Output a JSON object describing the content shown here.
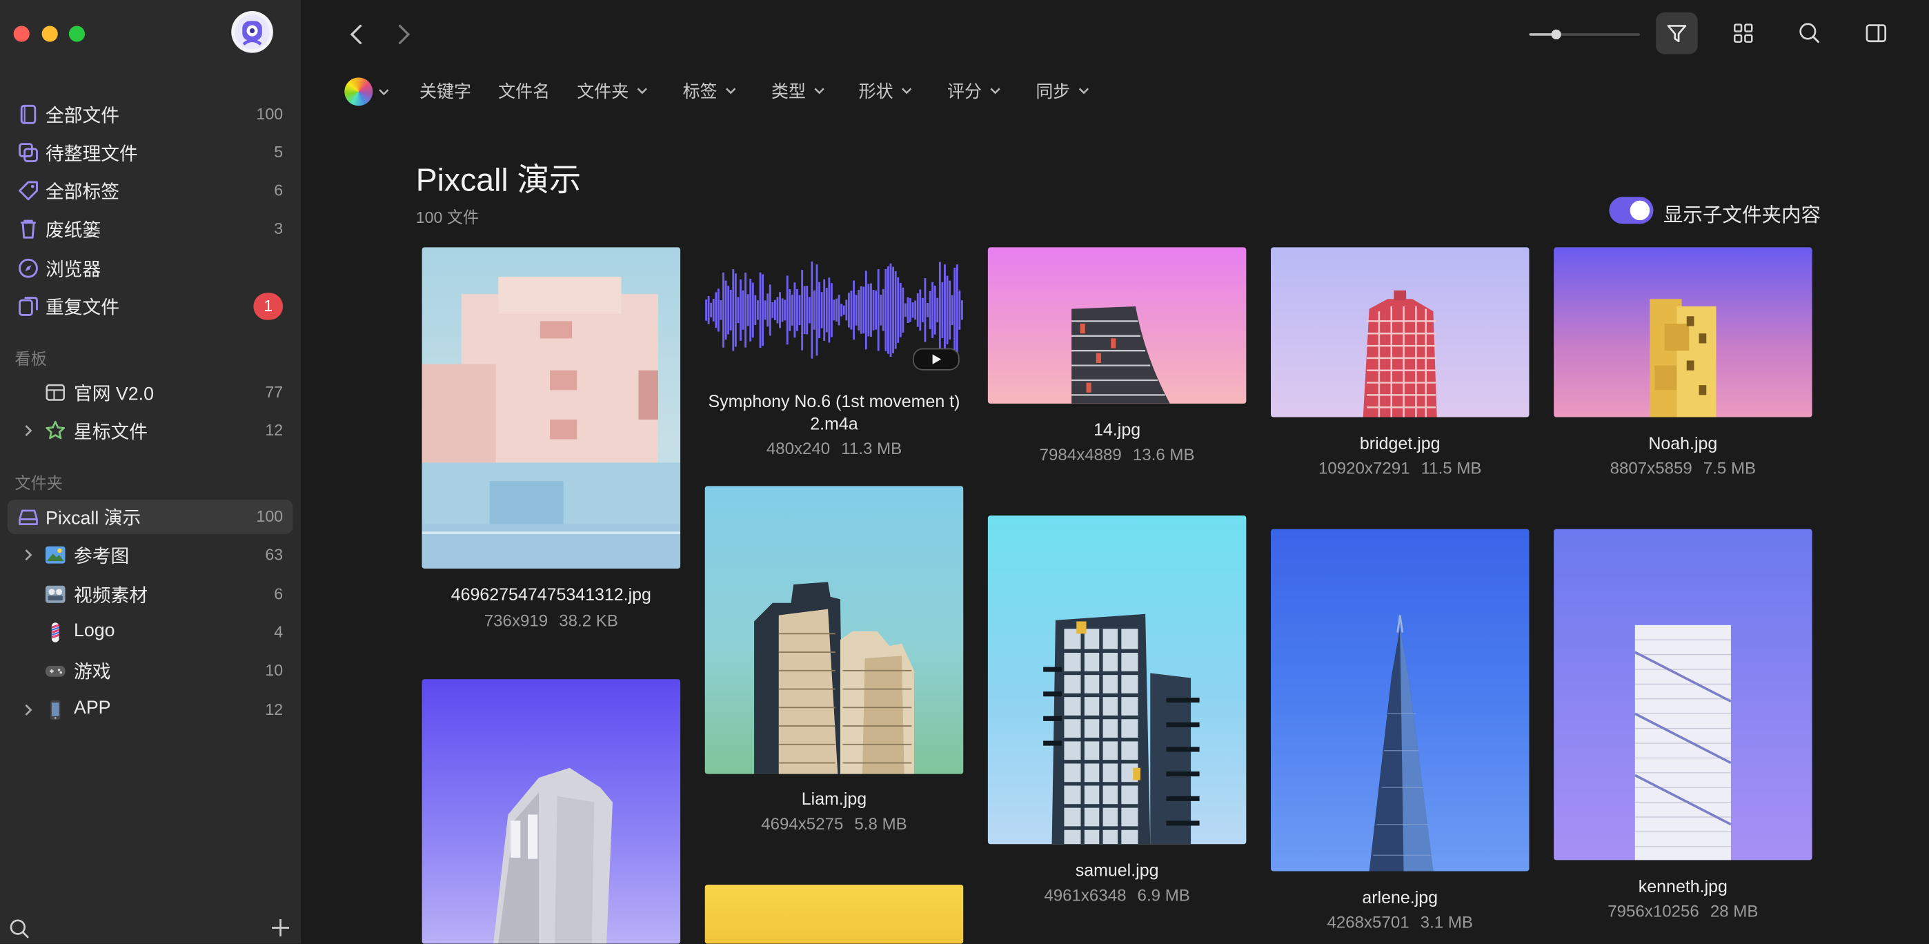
{
  "sidebar": {
    "library_items": [
      {
        "label": "全部文件",
        "count": "100",
        "icon": "all-files-icon"
      },
      {
        "label": "待整理文件",
        "count": "5",
        "icon": "unsorted-files-icon"
      },
      {
        "label": "全部标签",
        "count": "6",
        "icon": "tag-icon"
      },
      {
        "label": "废纸篓",
        "count": "3",
        "icon": "trash-icon"
      },
      {
        "label": "浏览器",
        "icon": "compass-icon"
      },
      {
        "label": "重复文件",
        "badge": "1",
        "icon": "duplicate-icon"
      }
    ],
    "boards_title": "看板",
    "boards": [
      {
        "label": "官网 V2.0",
        "count": "77",
        "icon": "board-icon"
      },
      {
        "label": "星标文件",
        "count": "12",
        "icon": "star-icon"
      }
    ],
    "folders_title": "文件夹",
    "folders": [
      {
        "label": "Pixcall 演示",
        "count": "100",
        "icon": "drive-icon"
      },
      {
        "label": "参考图",
        "count": "63",
        "icon": "picture-folder-icon"
      },
      {
        "label": "视频素材",
        "count": "6",
        "icon": "video-folder-icon"
      },
      {
        "label": "Logo",
        "count": "4",
        "icon": "logo-folder-icon"
      },
      {
        "label": "游戏",
        "count": "10",
        "icon": "game-folder-icon"
      },
      {
        "label": "APP",
        "count": "12",
        "icon": "phone-folder-icon"
      }
    ]
  },
  "filters": {
    "keyword": "关键字",
    "filename": "文件名",
    "folder": "文件夹",
    "tags": "标签",
    "type": "类型",
    "shape": "形状",
    "rating": "评分",
    "sync": "同步"
  },
  "header": {
    "title": "Pixcall 演示",
    "subtitle": "100 文件",
    "toggle_label": "显示子文件夹内容",
    "toggle_on": true
  },
  "files": [
    {
      "name": "469627547475341312.jpg",
      "dims": "736x919",
      "size": "38.2 KB"
    },
    {
      "name": "Symphony No.6 (1st movemen t) 2.m4a",
      "dims": "480x240",
      "size": "11.3 MB"
    },
    {
      "name": "14.jpg",
      "dims": "7984x4889",
      "size": "13.6 MB"
    },
    {
      "name": "bridget.jpg",
      "dims": "10920x7291",
      "size": "11.5 MB"
    },
    {
      "name": "Noah.jpg",
      "dims": "8807x5859",
      "size": "7.5 MB"
    },
    {
      "name": "Liam.jpg",
      "dims": "4694x5275",
      "size": "5.8 MB"
    },
    {
      "name": "samuel.jpg",
      "dims": "4961x6348",
      "size": "6.9 MB"
    },
    {
      "name": "arlene.jpg",
      "dims": "4268x5701",
      "size": "3.1 MB"
    },
    {
      "name": "kenneth.jpg",
      "dims": "7956x10256",
      "size": "28 MB"
    }
  ],
  "colors": {
    "accent": "#6c5ce7",
    "badge": "#e5484d",
    "sidebar": "#2b2b2b",
    "content": "#1b1b1b"
  }
}
